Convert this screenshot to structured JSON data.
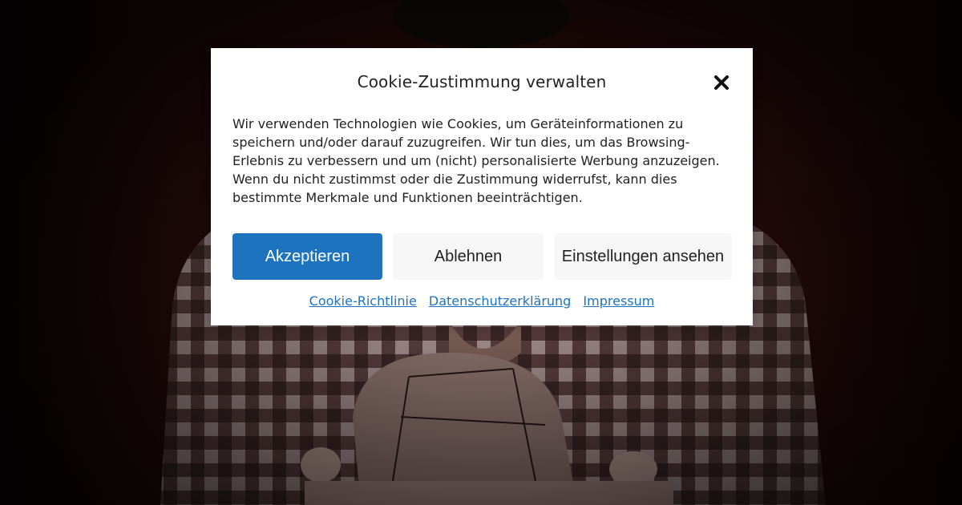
{
  "colors": {
    "accent": "#1e73be",
    "secondary_button_bg": "#f7f7f7",
    "text": "#222222",
    "modal_bg": "#ffffff"
  },
  "background": {
    "description_icon": "photo-person-plaid-shirt-holding-hat"
  },
  "modal": {
    "title": "Cookie-Zustimmung verwalten",
    "close_icon": "close-icon",
    "body_text": "Wir verwenden Technologien wie Cookies, um Geräteinformationen zu speichern und/oder darauf zuzugreifen. Wir tun dies, um das Browsing-Erlebnis zu verbessern und um (nicht) personalisierte Werbung anzuzeigen. Wenn du nicht zustimmst oder die Zustimmung widerrufst, kann dies bestimmte Merkmale und Funktionen beeinträchtigen.",
    "buttons": {
      "accept_label": "Akzeptieren",
      "deny_label": "Ablehnen",
      "settings_label": "Einstellungen ansehen"
    },
    "links": {
      "cookie_policy": "Cookie-Richtlinie",
      "privacy": "Datenschutzerklärung",
      "imprint": "Impressum"
    }
  }
}
